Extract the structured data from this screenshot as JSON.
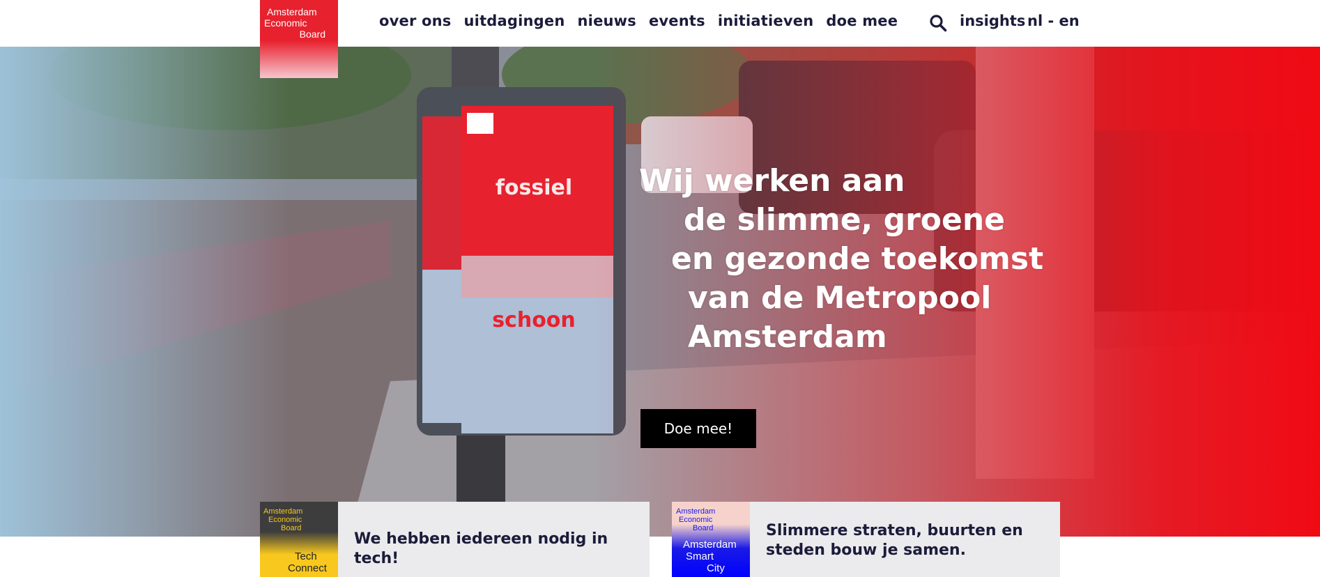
{
  "header": {
    "logo_lines": [
      "Amsterdam",
      "Economic",
      "Board"
    ],
    "nav": [
      "over ons",
      "uitdagingen",
      "nieuws",
      "events",
      "initiatieven",
      "doe mee"
    ],
    "search_icon": "search-icon",
    "insights": "insights",
    "lang_nl": "nl",
    "lang_sep": "-",
    "lang_en": "en"
  },
  "hero": {
    "headline_lines": [
      "Wij werken aan",
      "de slimme, groene",
      "en gezonde toekomst",
      "van de Metropool",
      "Amsterdam"
    ],
    "poster_top": "fossiel",
    "poster_bottom": "schoon",
    "cta": "Doe mee!"
  },
  "cards": [
    {
      "thumb_lines": [
        "Amsterdam",
        "Economic",
        "Board",
        "Tech",
        "Connect"
      ],
      "text": "We hebben iedereen nodig in tech!"
    },
    {
      "thumb_lines": [
        "Amsterdam",
        "Economic",
        "Board",
        "Amsterdam",
        "Smart",
        "City"
      ],
      "text": "Slimmere straten, buurten en steden bouw je samen."
    }
  ],
  "colors": {
    "brand_red": "#e8212e",
    "nav_text": "#1b1b3a",
    "hero_left_tint": "#a0c6de",
    "tech_yellow": "#f8c81e",
    "smartcity_blue": "#0000ff"
  }
}
